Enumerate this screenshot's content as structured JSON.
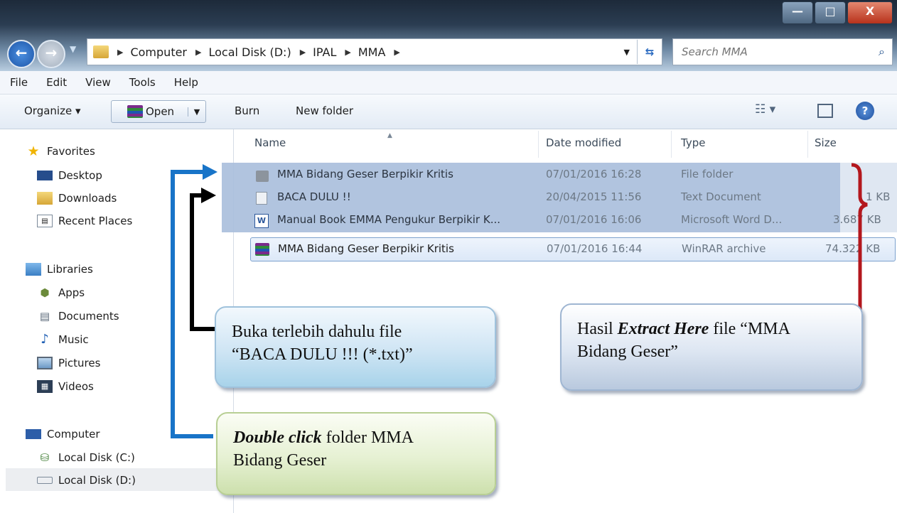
{
  "window": {
    "controls": [
      "—",
      "□",
      "X"
    ],
    "back_icon": "back-arrow-icon",
    "forward_icon": "forward-arrow-icon"
  },
  "address": {
    "crumbs": [
      "Computer",
      "Local Disk (D:)",
      "IPAL",
      "MMA"
    ],
    "refresh_icon": "refresh-icon"
  },
  "search": {
    "placeholder": "Search MMA"
  },
  "menu": [
    "File",
    "Edit",
    "View",
    "Tools",
    "Help"
  ],
  "toolbar": {
    "organize": "Organize ▾",
    "open": "Open",
    "burn": "Burn",
    "new_folder": "New folder"
  },
  "sidebar": {
    "favorites": "Favorites",
    "favorites_items": [
      "Desktop",
      "Downloads",
      "Recent Places"
    ],
    "libraries": "Libraries",
    "libraries_items": [
      "Apps",
      "Documents",
      "Music",
      "Pictures",
      "Videos"
    ],
    "computer": "Computer",
    "computer_items": [
      "Local Disk (C:)",
      "Local Disk (D:)"
    ]
  },
  "columns": [
    "Name",
    "Date modified",
    "Type",
    "Size"
  ],
  "files": [
    {
      "name": "MMA Bidang Geser Berpikir Kritis",
      "date": "07/01/2016 16:28",
      "type": "File folder",
      "size": "",
      "icon": "folder-icon"
    },
    {
      "name": "BACA DULU !!",
      "date": "20/04/2015 11:56",
      "type": "Text Document",
      "size": "1 KB",
      "icon": "text-document-icon"
    },
    {
      "name": "Manual Book EMMA Pengukur Berpikir K...",
      "date": "07/01/2016 16:06",
      "type": "Microsoft Word D...",
      "size": "3.687 KB",
      "icon": "word-document-icon"
    },
    {
      "name": "MMA Bidang Geser Berpikir Kritis",
      "date": "07/01/2016 16:44",
      "type": "WinRAR archive",
      "size": "74.322 KB",
      "icon": "winrar-archive-icon"
    }
  ],
  "callouts": {
    "baca": {
      "line1": "Buka terlebih dahulu file",
      "line2": "“BACA DULU !!! (*.txt)”"
    },
    "extract": {
      "pre": "Hasil ",
      "em": "Extract Here",
      "post": " file “MMA",
      "line2": "Bidang Geser”"
    },
    "double": {
      "em": "Double click",
      "post": " folder MMA",
      "line2": "Bidang Geser"
    }
  },
  "colors": {
    "selection": "#a9bedb",
    "arrow_blue": "#1874c8",
    "arrow_black": "#000000",
    "brace_red": "#b3171d"
  }
}
